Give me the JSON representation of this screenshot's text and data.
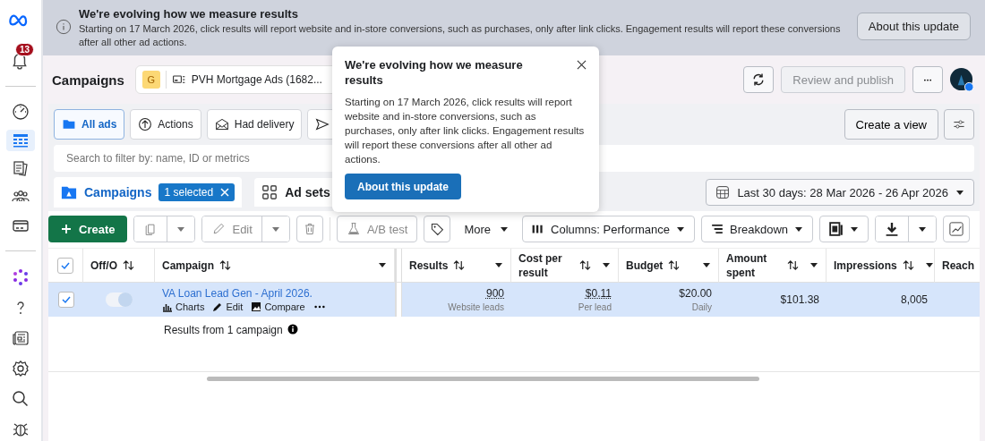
{
  "sidebar": {
    "notifications": "13",
    "items": [
      {
        "selected": false
      },
      {
        "selected": true
      },
      {
        "selected": false
      },
      {
        "selected": false
      },
      {
        "selected": false
      }
    ]
  },
  "banner": {
    "title": "We're evolving how we measure results",
    "text": "Starting on 17 March 2026, click results will report website and in-store conversions, such as purchases, only after link clicks. Engagement results will report these conversions after all other ad actions.",
    "button": "About this update"
  },
  "header": {
    "title": "Campaigns",
    "account_initial": "G",
    "account_name": "PVH Mortgage Ads (1682...",
    "review_button": {
      "label": "Review and publish",
      "disabled": true
    }
  },
  "filters": [
    {
      "label": "All ads",
      "selected": true
    },
    {
      "label": "Actions",
      "selected": false
    },
    {
      "label": "Had delivery",
      "selected": false
    }
  ],
  "create_view": "Create a view",
  "search": {
    "placeholder": "Search to filter by: name, ID or metrics"
  },
  "levels": [
    {
      "label": "Campaigns",
      "selected": true,
      "badge": "1 selected"
    },
    {
      "label": "Ad sets",
      "selected": false
    }
  ],
  "date_range": "Last 30 days: 28 Mar 2026 - 26 Apr 2026",
  "toolbar": {
    "create": "Create",
    "edit": "Edit",
    "ab_test": "A/B test",
    "more": "More",
    "columns": "Columns: Performance",
    "breakdown": "Breakdown"
  },
  "table": {
    "all_checked": true,
    "columns": [
      "Off/O",
      "Campaign",
      "Results",
      "Cost per result",
      "Budget",
      "Amount spent",
      "Impressions",
      "Reach"
    ],
    "rows": [
      {
        "selected": true,
        "checked": true,
        "on": true,
        "name": "VA Loan Lead Gen - April 2026.",
        "actions": [
          "Charts",
          "Edit",
          "Compare"
        ],
        "results": "900",
        "results_sub": "Website leads",
        "cost": "$0.11",
        "cost_sub": "Per lead",
        "budget": "$20.00",
        "budget_sub": "Daily",
        "amount": "$101.38",
        "impressions": "8,005"
      }
    ],
    "summary": "Results from 1 campaign"
  },
  "popover": {
    "title": "We're evolving how we measure results",
    "text": "Starting on 17 March 2026, click results will report website and in-store conversions, such as purchases, only after link clicks. Engagement results will report these conversions after all other ad actions.",
    "button": "About this update"
  }
}
